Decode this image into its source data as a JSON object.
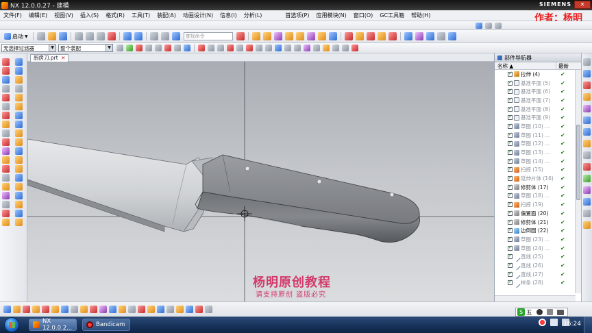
{
  "window": {
    "title": "NX 12.0.0.27 - 建模",
    "brand": "SIEMENS",
    "author_label": "作者：杨明"
  },
  "menu": [
    "文件(F)",
    "编辑(E)",
    "视图(V)",
    "插入(S)",
    "格式(R)",
    "工具(T)",
    "装配(A)",
    "动画设计(N)",
    "信息(I)",
    "分析(L)",
    "首选项(P)",
    "应用模块(N)",
    "窗口(O)",
    "GC工具箱",
    "帮助(H)"
  ],
  "toolbar": {
    "start_label": "启动",
    "search_placeholder": "查找命令",
    "filter_value": "无选择过滤器",
    "assembly_value": "整个装配"
  },
  "document_tab": {
    "label": "厨房刀.prt"
  },
  "watermark": {
    "line1": "杨明原创教程",
    "line2": "请支持原创 盗版必究"
  },
  "navigator": {
    "title": "部件导航器",
    "col_name": "名称",
    "col_latest": "最新",
    "items": [
      {
        "icon": "ext",
        "label": "拉伸 (4)",
        "dim": false
      },
      {
        "icon": "plane",
        "label": "基准平面 (5)",
        "dim": true
      },
      {
        "icon": "plane",
        "label": "基准平面 (6)",
        "dim": true
      },
      {
        "icon": "plane",
        "label": "基准平面 (7)",
        "dim": true
      },
      {
        "icon": "plane",
        "label": "基准平面 (8)",
        "dim": true
      },
      {
        "icon": "plane",
        "label": "基准平面 (9)",
        "dim": true
      },
      {
        "icon": "sketch",
        "label": "草图 (10) ...",
        "dim": true
      },
      {
        "icon": "sketch",
        "label": "草图 (11) ...",
        "dim": true
      },
      {
        "icon": "sketch",
        "label": "草图 (12) ...",
        "dim": true
      },
      {
        "icon": "sketch",
        "label": "草图 (13) ...",
        "dim": true
      },
      {
        "icon": "sketch",
        "label": "草图 (14) ...",
        "dim": true
      },
      {
        "icon": "sweep",
        "label": "扫掠 (15)",
        "dim": true
      },
      {
        "icon": "sweep",
        "label": "延伸片体 (16)",
        "dim": true
      },
      {
        "icon": "trim",
        "label": "修剪体 (17)",
        "dim": false
      },
      {
        "icon": "sketch",
        "label": "草图 (18) ...",
        "dim": true
      },
      {
        "icon": "sweep",
        "label": "扫掠 (19)",
        "dim": true
      },
      {
        "icon": "trim",
        "label": "偏置面 (20)",
        "dim": false
      },
      {
        "icon": "trim",
        "label": "修剪体 (21)",
        "dim": false
      },
      {
        "icon": "edge",
        "label": "边倒圆 (22)",
        "dim": false
      },
      {
        "icon": "sketch",
        "label": "草图 (23) ...",
        "dim": true
      },
      {
        "icon": "sketch",
        "label": "草图 (24) ...",
        "dim": true
      },
      {
        "icon": "line",
        "label": "直线 (25)",
        "dim": true
      },
      {
        "icon": "line",
        "label": "直线 (26)",
        "dim": true
      },
      {
        "icon": "line",
        "label": "直线 (27)",
        "dim": true
      },
      {
        "icon": "line",
        "label": "样条 (28)",
        "dim": true
      }
    ]
  },
  "taskbar": {
    "items": [
      "NX 12.0.0.2...",
      "Bandicam"
    ],
    "ime_label": "五",
    "clock": "16:24"
  },
  "icons": {
    "title": "nx-logo-icon",
    "tray": [
      "sogou-icon",
      "network-icon",
      "volume-icon",
      "record-icon"
    ]
  }
}
